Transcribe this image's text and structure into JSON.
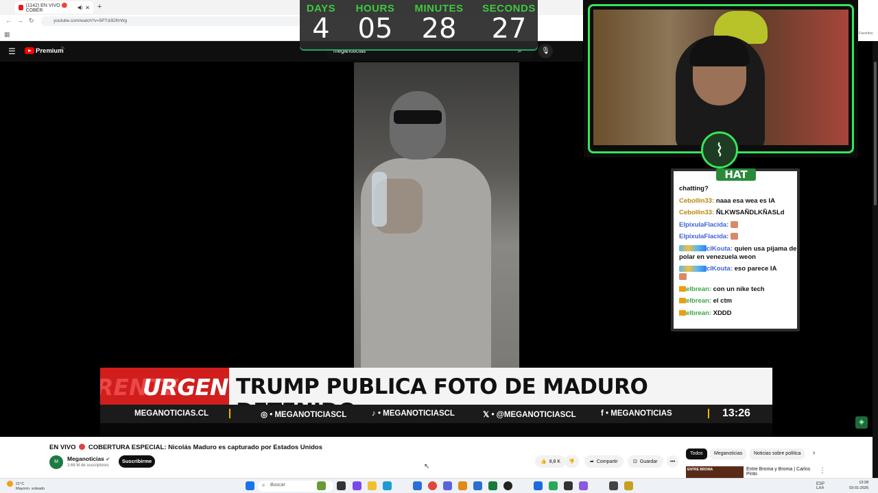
{
  "browser": {
    "tab_title": "(1142) EN VIVO 🔴 COBER",
    "address": "youtube.com/watch?v=5PTd3DRrWg",
    "right_label": "Favoritos"
  },
  "countdown": {
    "days_label": "DAYS",
    "days": "4",
    "hours_label": "HOURS",
    "hours": "05",
    "minutes_label": "MINUTES",
    "minutes": "28",
    "seconds_label": "SECONDS",
    "seconds": "27"
  },
  "youtube": {
    "brand": "Premium",
    "region": "CL",
    "search_value": "meganoticias"
  },
  "video": {
    "urgent_ghost": "RENTE",
    "urgent": "URGENTE",
    "urgent_ghost_r": "UR",
    "headline": "TRUMP PUBLICA FOTO DE MADURO DETENIDO",
    "social": {
      "site": "MEGANOTICIAS.CL",
      "instagram": "◎ • MEGANOTICIASCL",
      "tiktok": "♪ • MEGANOTICIASCL",
      "x": "𝕏 • @MEGANOTICIASCL",
      "facebook": "f • MEGANOTICIAS",
      "time": "13:26"
    }
  },
  "chat": {
    "title": "HAT",
    "messages": [
      {
        "user": "",
        "text": "chatting?"
      },
      {
        "user": "Cebollin33:",
        "text": "naaa esa wea es IA"
      },
      {
        "user": "Cebollin33:",
        "text": "ÑLKWSAÑDLKÑASLd"
      },
      {
        "user": "ElpixulaFlacida:",
        "text": ""
      },
      {
        "user": "ElpixulaFlacida:",
        "text": ""
      },
      {
        "user": "clKouta:",
        "text": "quien usa pijama de polar en venezuela weon"
      },
      {
        "user": "clKouta:",
        "text": "eso parece IA"
      },
      {
        "user": "elbrean:",
        "text": "con un nike tech"
      },
      {
        "user": "elbrean:",
        "text": "el ctm"
      },
      {
        "user": "elbrean:",
        "text": "XDDD"
      }
    ]
  },
  "below": {
    "title_prefix": "EN VIVO",
    "title": "COBERTURA ESPECIAL: Nicolás Maduro es capturado por Estados Unidos",
    "channel": "Meganoticias",
    "subs": "3,68 M de suscriptores",
    "subscribe": "Suscribirme",
    "likes": "8,8 K",
    "share": "Compartir",
    "save": "Guardar",
    "more": "•••",
    "chips": [
      "Todos",
      "Meganoticias",
      "Noticias sobre política"
    ],
    "rec_thumb": "ENTRE BROMA",
    "rec_title": "Entre Broma y Broma | Carlos Pinto"
  },
  "taskbar": {
    "temp": "21°C",
    "weather": "Mayorm. soleado",
    "search": "Buscar",
    "lang": "ESP",
    "lang2": "LAA",
    "time": "13:28",
    "date": "03-01-2026"
  }
}
